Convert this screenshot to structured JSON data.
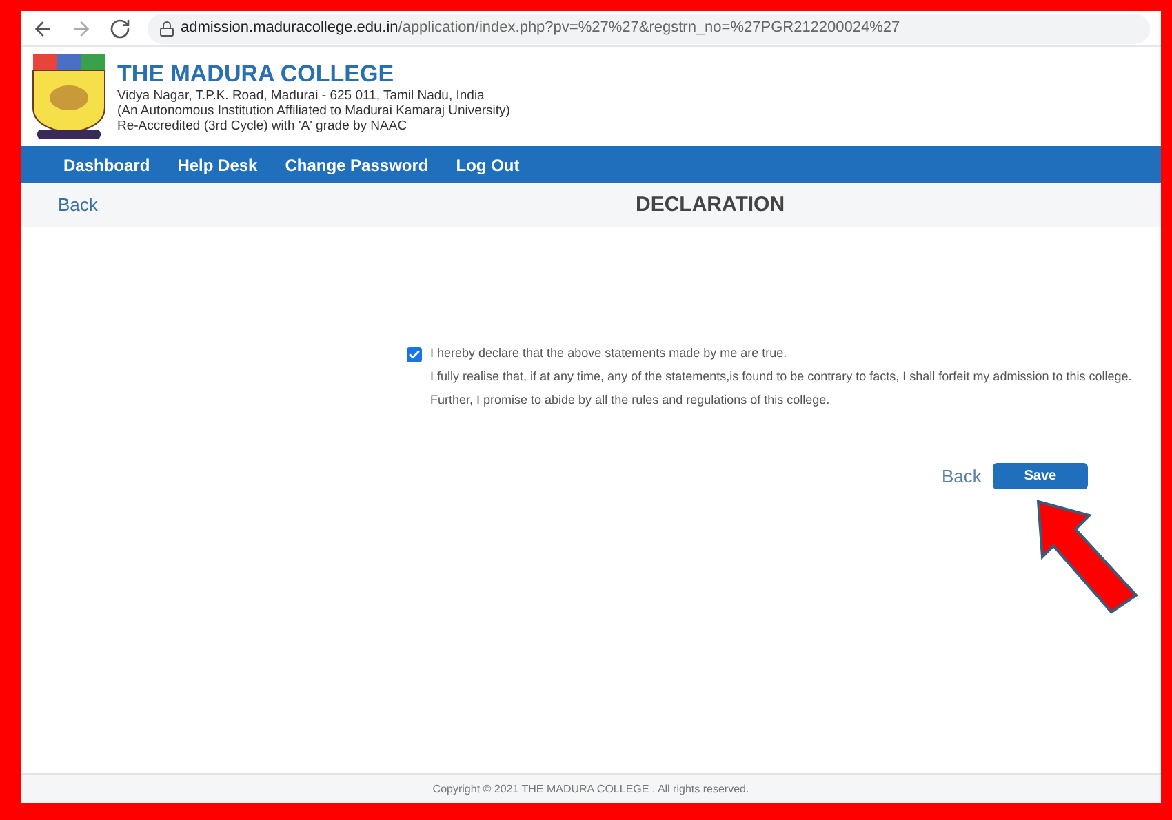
{
  "browser": {
    "url_host": "admission.maduracollege.edu.in",
    "url_path": "/application/index.php?pv=%27%27&regstrn_no=%27PGR212200024%27"
  },
  "header": {
    "title": "THE MADURA COLLEGE",
    "lines": [
      "Vidya Nagar, T.P.K. Road, Madurai - 625 011, Tamil Nadu, India",
      "(An Autonomous Institution Affiliated to Madurai Kamaraj University)",
      "Re-Accredited (3rd Cycle) with 'A' grade by NAAC"
    ]
  },
  "nav": [
    "Dashboard",
    "Help Desk",
    "Change Password",
    "Log Out"
  ],
  "subheader": {
    "back": "Back",
    "title": "DECLARATION"
  },
  "declaration": {
    "checked": true,
    "lines": [
      "I hereby declare that the above statements made by me are true.",
      "I fully realise that, if at any time, any of the statements,is found to be contrary to facts, I shall forfeit my admission to this college.",
      "Further, I promise to abide by all the rules and regulations of this college."
    ]
  },
  "actions": {
    "back": "Back",
    "save": "Save"
  },
  "footer": "Copyright © 2021 THE MADURA COLLEGE . All rights reserved."
}
